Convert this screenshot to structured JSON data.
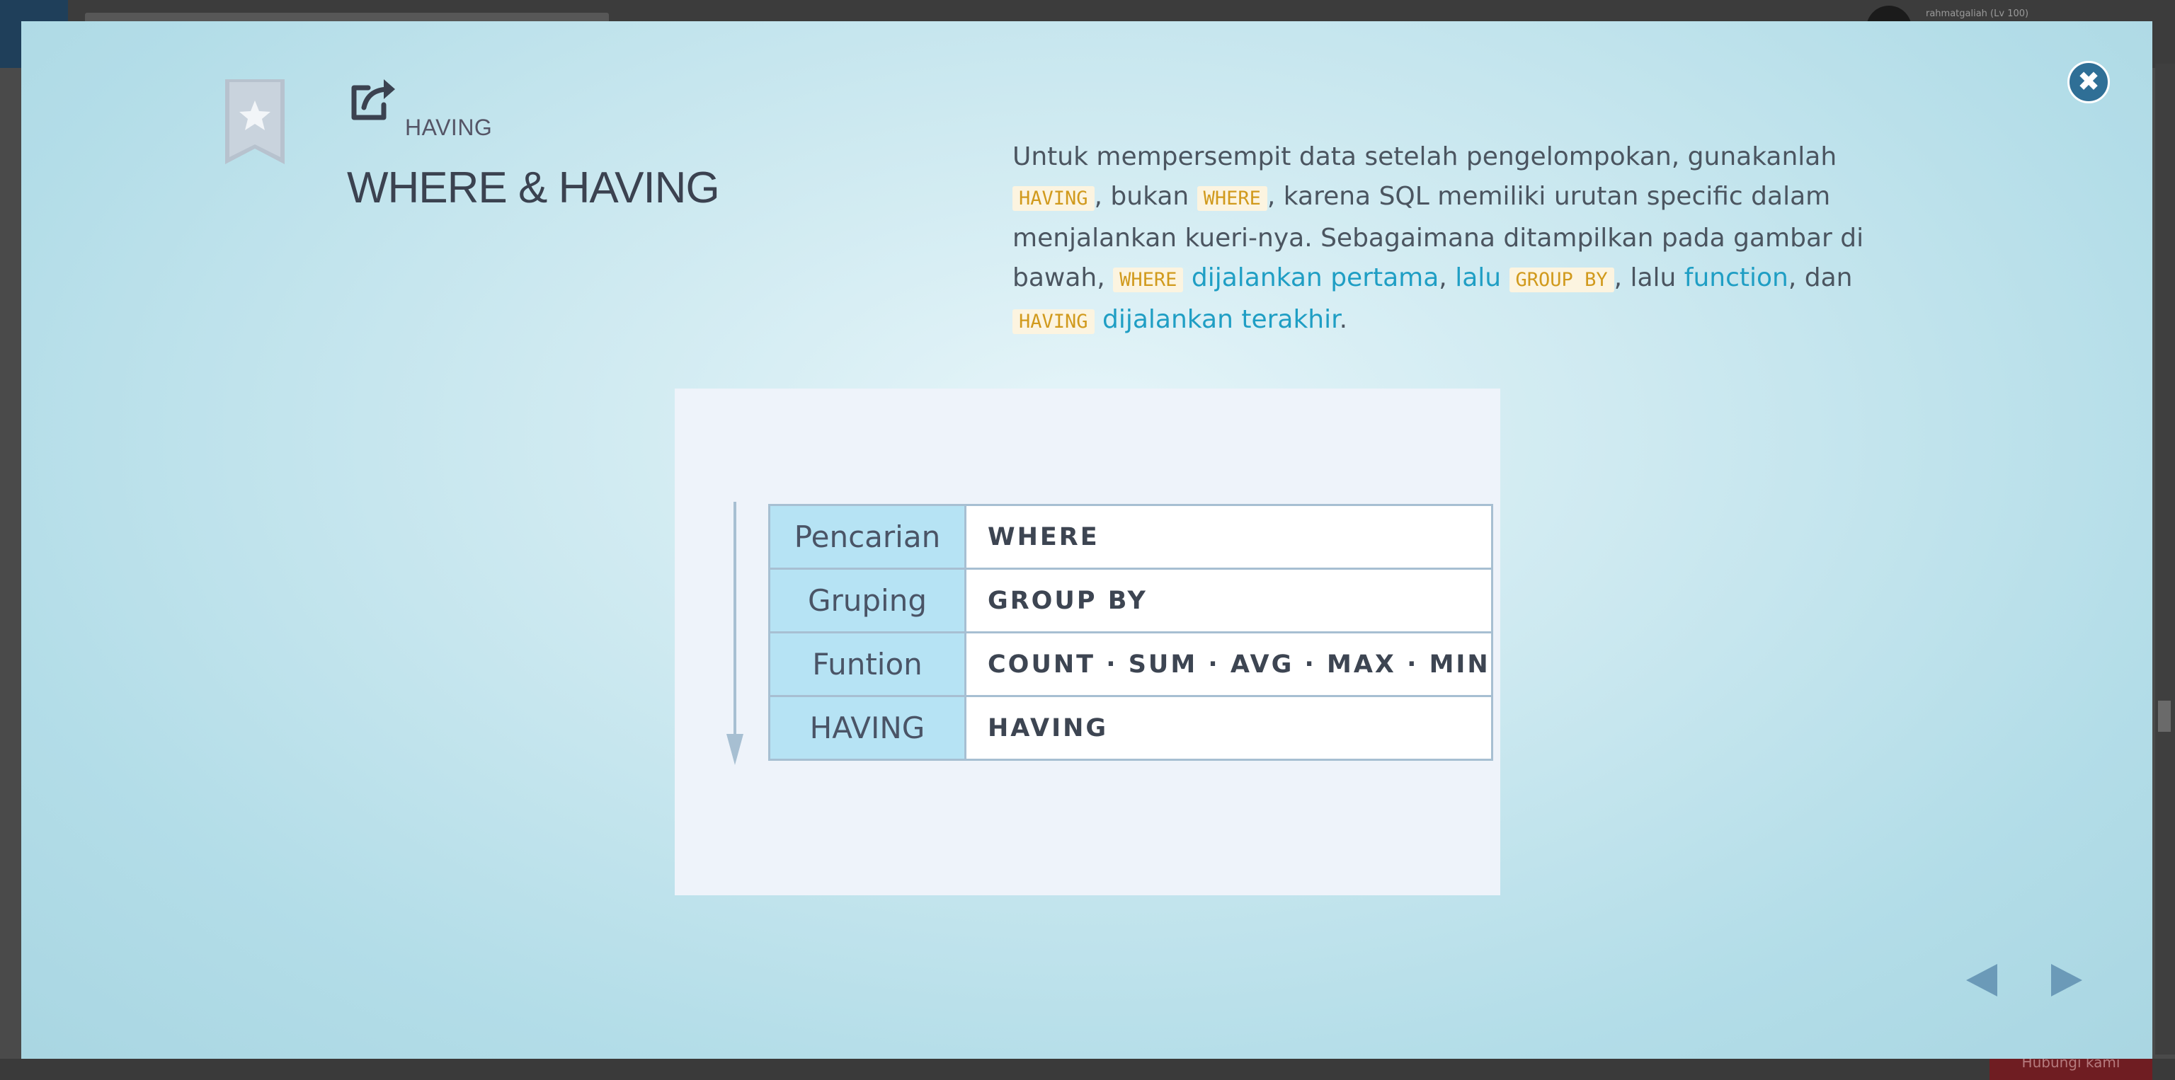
{
  "background_app": {
    "username": "rahmatgaliah (Lv 100)",
    "contact_button": "Hubungi kami"
  },
  "modal": {
    "kicker": "HAVING",
    "title": "WHERE & HAVING",
    "description": {
      "intro": "Untuk mempersempit data setelah pengelompokan, gunakanlah ",
      "code_having": "HAVING",
      "t_bukan": ", bukan ",
      "code_where": "WHERE",
      "t_karena": ", karena SQL memiliki urutan specific dalam menjalankan kueri-nya. Sebagaimana ditampilkan pada gambar di bawah, ",
      "code_where2": "WHERE",
      "hl_first": "dijalankan pertama",
      "t_comma": ", ",
      "hl_lalu": "lalu",
      "code_groupby": "GROUP BY",
      "t_lalu2": ", lalu ",
      "hl_function": "function",
      "t_dan": ", dan ",
      "code_having2": "HAVING",
      "hl_last": "dijalankan terakhir",
      "t_end": "."
    },
    "diagram": {
      "rows": [
        {
          "label": "Pencarian",
          "value": "WHERE"
        },
        {
          "label": "Gruping",
          "value": "GROUP BY"
        },
        {
          "label": "Funtion",
          "value": "COUNT · SUM · AVG · MAX · MIN"
        },
        {
          "label": "HAVING",
          "value": "HAVING"
        }
      ]
    },
    "colors": {
      "accent": "#2f6f96",
      "highlight": "#1f9ec4",
      "code_text": "#d19a1d",
      "label_cell": "#b6e3f4"
    },
    "icons": {
      "close": "close-icon",
      "bookmark": "bookmark-star-icon",
      "external": "external-link-icon",
      "prev": "triangle-left-icon",
      "next": "triangle-right-icon"
    }
  }
}
